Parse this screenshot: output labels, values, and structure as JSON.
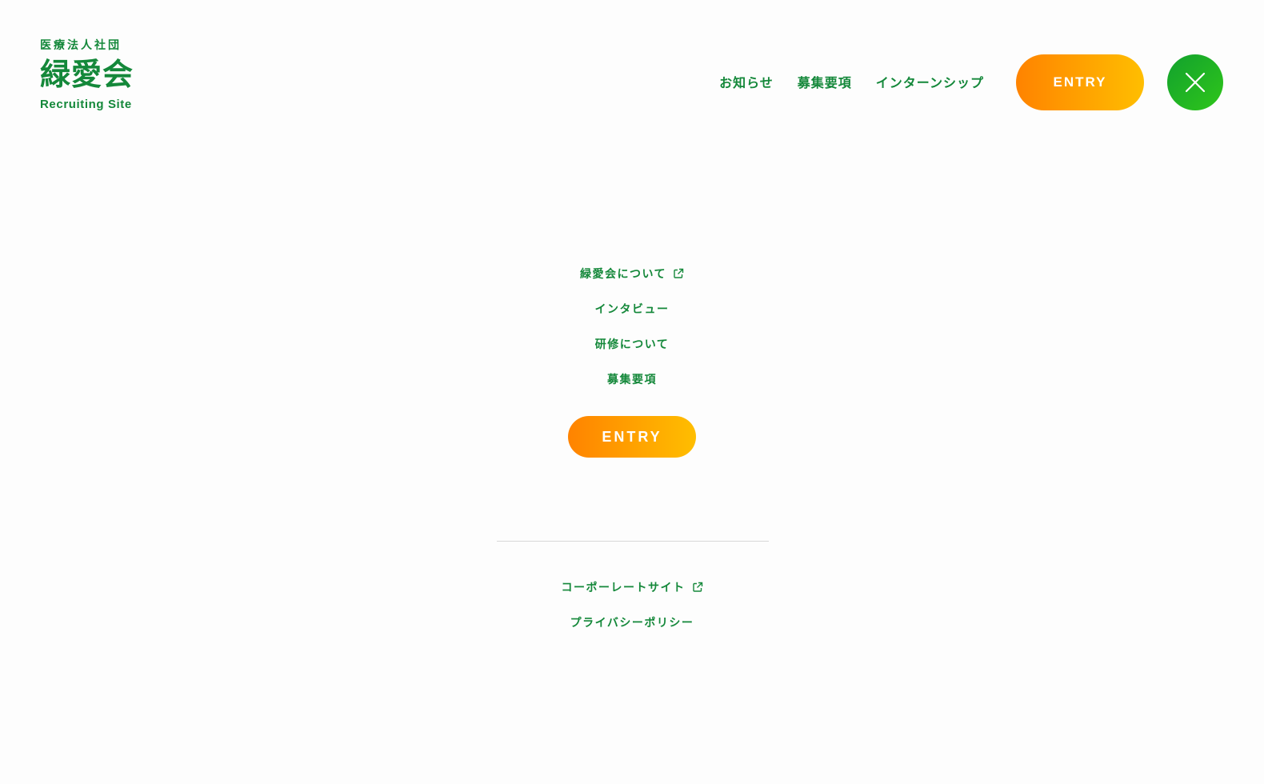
{
  "brand": {
    "subtitle": "医療法人社団",
    "name": "緑愛会",
    "tagline": "Recruiting Site"
  },
  "header_nav": {
    "items": [
      "お知らせ",
      "募集要項",
      "インターンシップ"
    ],
    "entry_label": "ENTRY"
  },
  "menu": {
    "items": [
      {
        "label": "緑愛会について",
        "external": true
      },
      {
        "label": "インタビュー",
        "external": false
      },
      {
        "label": "研修について",
        "external": false
      },
      {
        "label": "募集要項",
        "external": false
      }
    ],
    "entry_label": "ENTRY"
  },
  "sub_menu": {
    "items": [
      {
        "label": "コーポーレートサイト",
        "external": true
      },
      {
        "label": "プライバシーポリシー",
        "external": false
      }
    ]
  },
  "icons": {
    "close": "close-icon",
    "external": "external-link-icon"
  },
  "colors": {
    "brand_green": "#14883a",
    "entry_gradient_start": "#ff8300",
    "entry_gradient_end": "#ffbe00",
    "close_gradient_start": "#12a12e",
    "close_gradient_end": "#2fc61a",
    "background": "#fdfdfd"
  }
}
